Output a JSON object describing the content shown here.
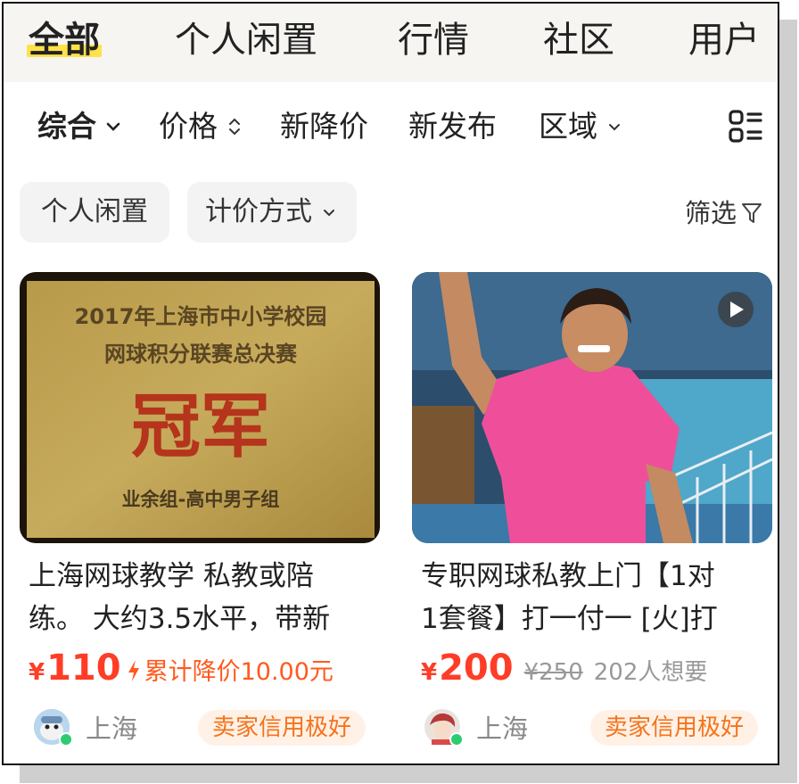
{
  "tabs": [
    {
      "label": "全部",
      "active": true
    },
    {
      "label": "个人闲置"
    },
    {
      "label": "行情"
    },
    {
      "label": "社区"
    },
    {
      "label": "用户"
    }
  ],
  "sort_options": [
    {
      "label": "综合",
      "icon": "chevron-down-icon"
    },
    {
      "label": "价格",
      "icon": "sort-updown-icon"
    },
    {
      "label": "新降价"
    },
    {
      "label": "新发布"
    },
    {
      "label": "区域",
      "icon": "chevron-down-icon"
    }
  ],
  "layout_toggle_icon": "list-grid-icon",
  "chips": [
    {
      "label": "个人闲置"
    },
    {
      "label": "计价方式",
      "icon": "chevron-down-icon"
    }
  ],
  "filter": {
    "label": "筛选",
    "icon": "funnel-icon"
  },
  "items": [
    {
      "image_text": {
        "line1": "2017年上海市中小学校园",
        "line2": "网球积分联赛总决赛",
        "big": "冠军",
        "line3": "业余组-高中男子组"
      },
      "title_line1": "上海网球教学 私教或陪",
      "title_line2": "练。 大约3.5水平，带新",
      "currency": "¥",
      "price": "110",
      "price_drop": "累计降价10.00元",
      "location": "上海",
      "badge": "卖家信用极好"
    },
    {
      "image_icon": "video-play-icon",
      "title_line1": "专职网球私教上门【1对",
      "title_line2": "1套餐】打一付一 [火]打",
      "currency": "¥",
      "price": "200",
      "original_price": "¥250",
      "wants": "202人想要",
      "location": "上海",
      "badge": "卖家信用极好"
    }
  ],
  "colors": {
    "accent": "#ff3d27",
    "highlight": "#ffe14a",
    "badge_text": "#f5731b"
  }
}
